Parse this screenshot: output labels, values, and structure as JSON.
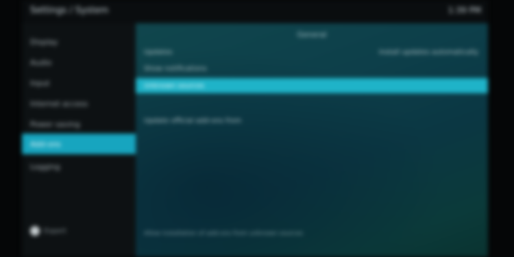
{
  "window": {
    "breadcrumb": "Settings / System",
    "clock": "1:39 PM"
  },
  "sidebar": {
    "items": [
      {
        "label": "Display"
      },
      {
        "label": "Audio"
      },
      {
        "label": "Input"
      },
      {
        "label": "Internet access"
      },
      {
        "label": "Power saving"
      },
      {
        "label": "Add-ons"
      },
      {
        "label": "Logging"
      }
    ],
    "active_index": 5,
    "footer_label": "Expert"
  },
  "main": {
    "heading": "General",
    "rows": [
      {
        "label": "Updates",
        "value": "Install updates automatically"
      },
      {
        "label": "Show notifications",
        "value": ""
      },
      {
        "label": "Unknown sources",
        "value": ""
      },
      {
        "label": "Update official add-ons from",
        "value": ""
      }
    ],
    "hint": "Allow installation of add-ons from unknown sources"
  },
  "colors": {
    "accent": "#17a5bf",
    "highlight_row": "#1fb3c8",
    "panel_bg": "#0d3f4a"
  }
}
